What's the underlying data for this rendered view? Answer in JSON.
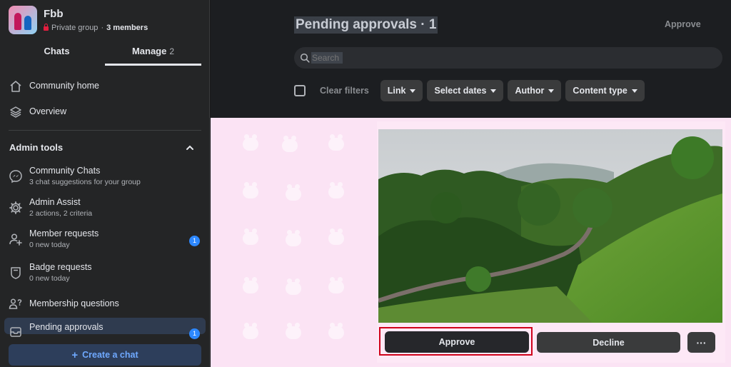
{
  "group": {
    "name": "Fbb",
    "privacy": "Private group",
    "separator": "·",
    "members": "3 members"
  },
  "tabs": [
    {
      "label": "Chats",
      "count": ""
    },
    {
      "label": "Manage",
      "count": "2"
    }
  ],
  "nav_top": [
    {
      "label": "Community home",
      "icon": "home-icon"
    },
    {
      "label": "Overview",
      "icon": "layers-icon"
    }
  ],
  "admin_tools": {
    "title": "Admin tools",
    "items": [
      {
        "label": "Community Chats",
        "sub": "3 chat suggestions for your group",
        "icon": "messenger-icon",
        "badge": ""
      },
      {
        "label": "Admin Assist",
        "sub": "2 actions, 2 criteria",
        "icon": "gear-icon",
        "badge": ""
      },
      {
        "label": "Member requests",
        "sub": "0 new today",
        "icon": "add-person-icon",
        "badge": "1"
      },
      {
        "label": "Badge requests",
        "sub": "0 new today",
        "icon": "shield-icon",
        "badge": ""
      },
      {
        "label": "Membership questions",
        "sub": "",
        "icon": "people-question-icon",
        "badge": ""
      },
      {
        "label": "Pending approvals",
        "sub": "",
        "icon": "tray-icon",
        "badge": "1"
      }
    ]
  },
  "create_chat": {
    "label": "Create a chat",
    "icon": "plus"
  },
  "main": {
    "title": "Pending approvals · 1",
    "approve_all": "Approve",
    "search_placeholder": "Search",
    "clear_filters": "Clear filters",
    "filters": [
      "Link",
      "Select dates",
      "Author",
      "Content type"
    ]
  },
  "post": {
    "approve": "Approve",
    "decline": "Decline",
    "more": "···"
  },
  "colors": {
    "accent": "#2d88ff",
    "highlight": "#d0021b",
    "content_bg": "#fbe3f4"
  }
}
